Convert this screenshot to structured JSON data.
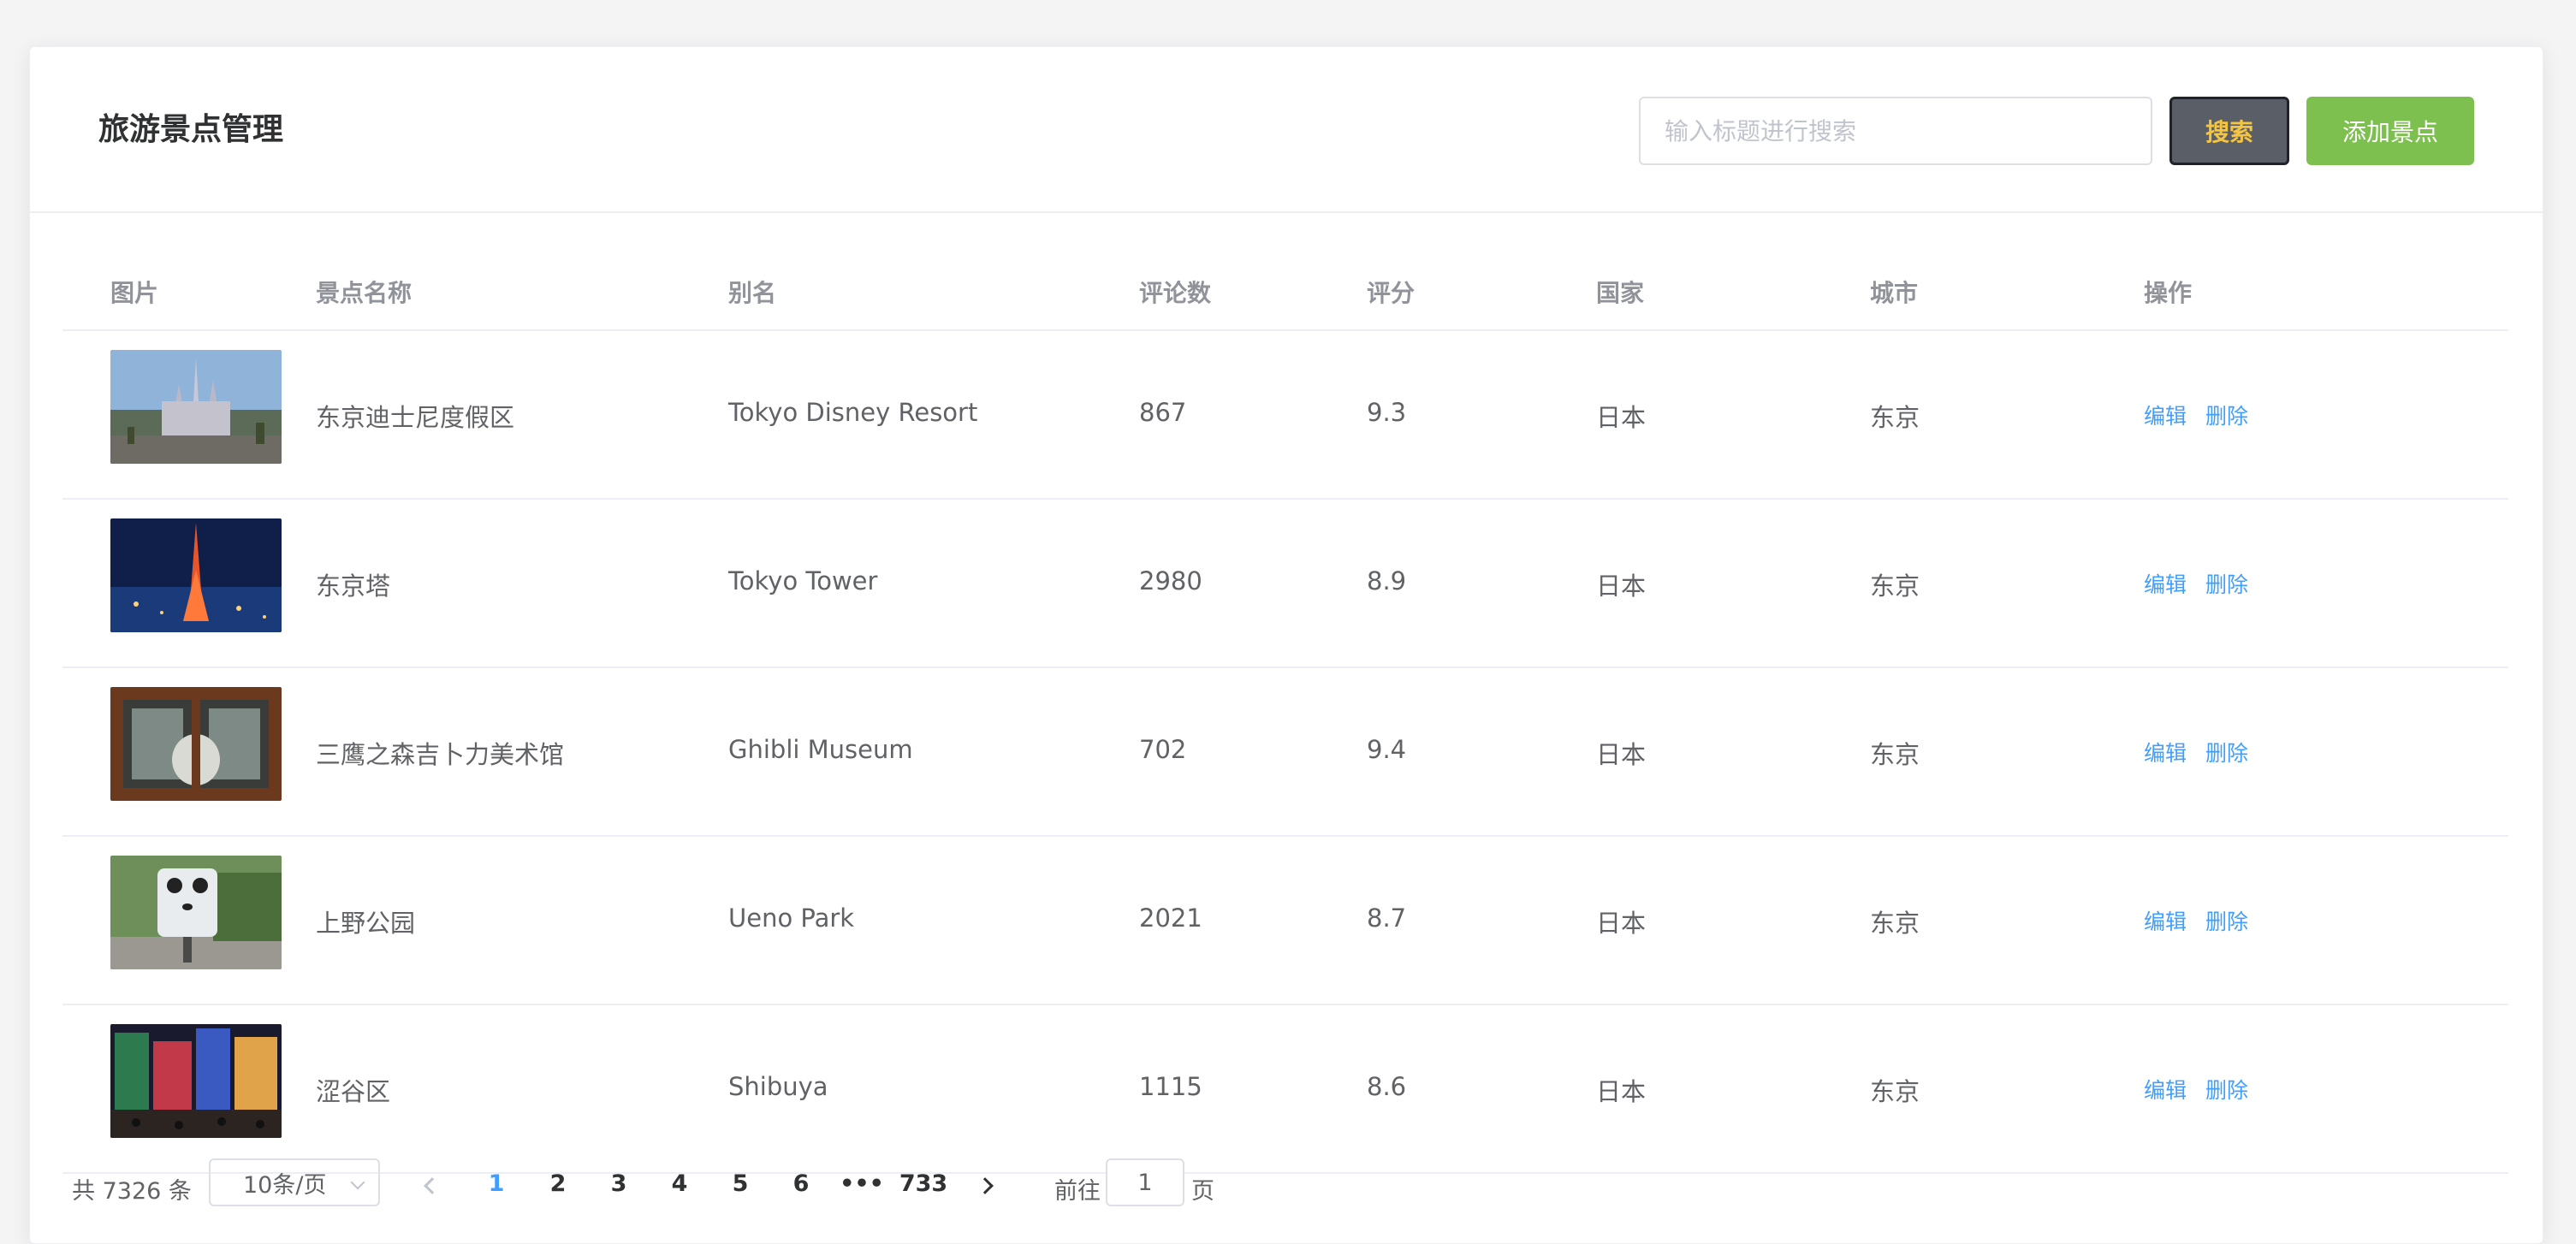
{
  "header": {
    "title": "旅游景点管理",
    "search_placeholder": "输入标题进行搜索",
    "search_value": "",
    "search_button": "搜索",
    "add_button": "添加景点"
  },
  "colors": {
    "primary": "#409eff",
    "success": "#7ec050",
    "search_button_bg": "#5a5f67",
    "search_button_text": "#f5c542"
  },
  "table": {
    "columns": [
      "图片",
      "景点名称",
      "别名",
      "评论数",
      "评分",
      "国家",
      "城市",
      "操作"
    ],
    "rows": [
      {
        "name": "东京迪士尼度假区",
        "alias": "Tokyo Disney Resort",
        "reviews": "867",
        "rating": "9.3",
        "country": "日本",
        "city": "东京",
        "image": "castle-photo"
      },
      {
        "name": "东京塔",
        "alias": "Tokyo Tower",
        "reviews": "2980",
        "rating": "8.9",
        "country": "日本",
        "city": "东京",
        "image": "tower-night-photo"
      },
      {
        "name": "三鹰之森吉卜力美术馆",
        "alias": "Ghibli Museum",
        "reviews": "702",
        "rating": "9.4",
        "country": "日本",
        "city": "东京",
        "image": "museum-window-photo"
      },
      {
        "name": "上野公园",
        "alias": "Ueno Park",
        "reviews": "2021",
        "rating": "8.7",
        "country": "日本",
        "city": "东京",
        "image": "panda-sign-photo"
      },
      {
        "name": "涩谷区",
        "alias": "Shibuya",
        "reviews": "1115",
        "rating": "8.6",
        "country": "日本",
        "city": "东京",
        "image": "city-night-photo"
      }
    ],
    "actions": {
      "edit": "编辑",
      "delete": "删除"
    }
  },
  "pagination": {
    "total_text": "共 7326 条",
    "page_size": "10条/页",
    "pages": [
      "1",
      "2",
      "3",
      "4",
      "5",
      "6",
      "•••",
      "733"
    ],
    "current_page": "1",
    "goto_label": "前往",
    "goto_value": "1",
    "goto_suffix": "页"
  }
}
